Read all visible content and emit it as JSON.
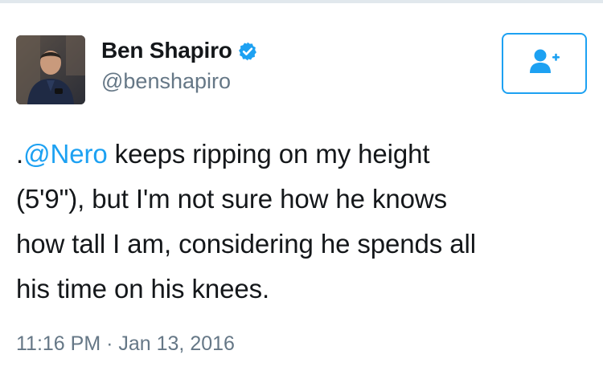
{
  "user": {
    "display_name": "Ben Shapiro",
    "handle": "@benshapiro",
    "verified": true
  },
  "follow_button": {
    "icon": "add-user-icon"
  },
  "tweet": {
    "lead": ".",
    "mention": "@Nero",
    "line1_rest": " keeps ripping on my height",
    "line2": "(5'9\"), but I'm not sure how he knows",
    "line3": "how tall I am, considering he spends all",
    "line4": "his time on his knees."
  },
  "timestamp": "11:16 PM · Jan 13, 2016",
  "colors": {
    "accent": "#1da1f2",
    "secondary_text": "#657786",
    "primary_text": "#14171a"
  }
}
